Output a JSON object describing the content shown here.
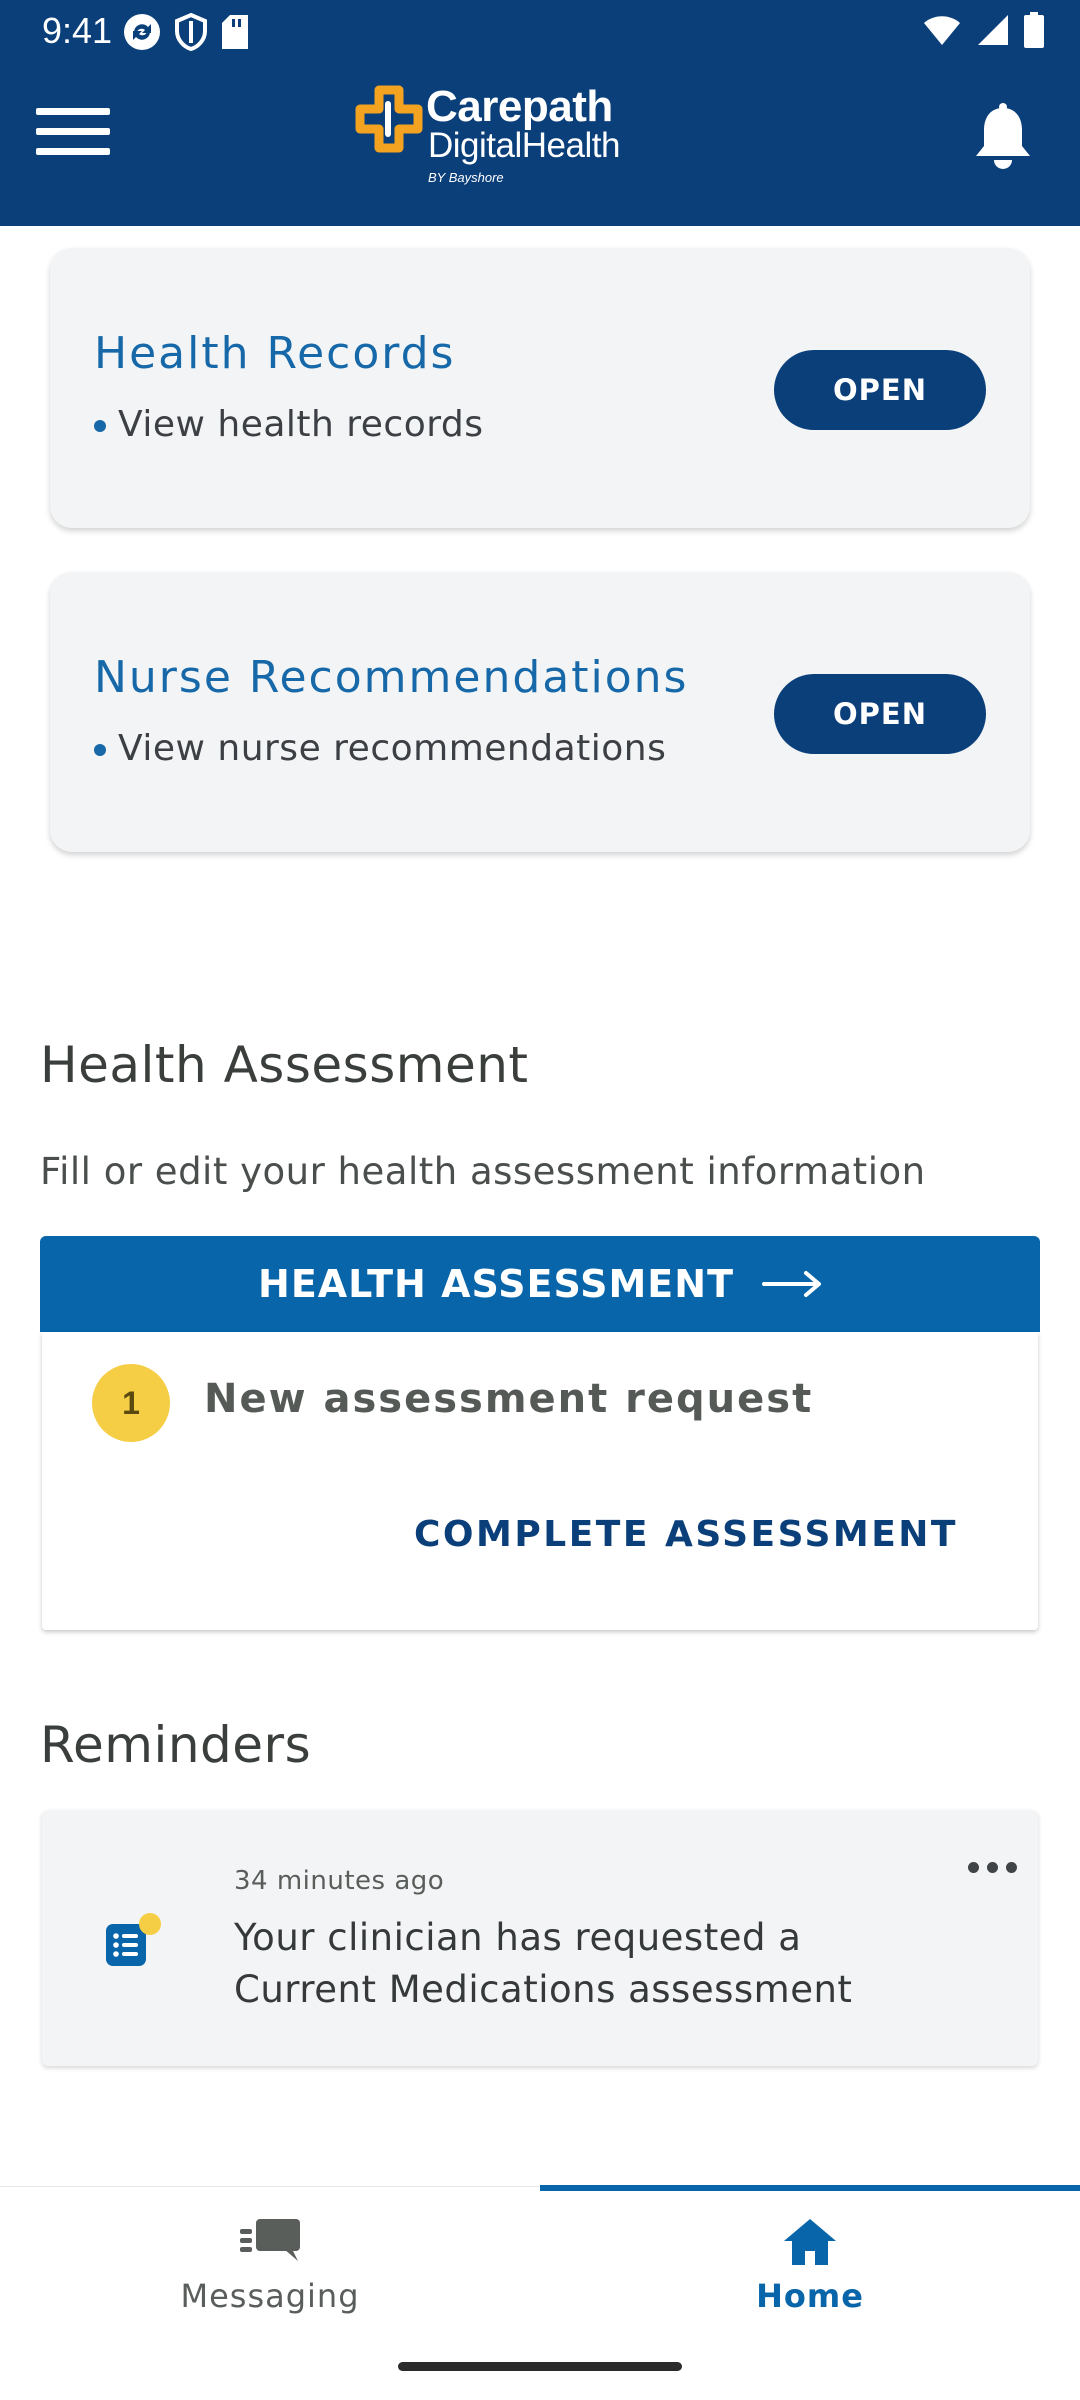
{
  "status_bar": {
    "time": "9:41"
  },
  "header": {
    "logo_line1": "Carepath",
    "logo_line2": "DigitalHealth",
    "logo_line3": "BY Bayshore"
  },
  "cards": [
    {
      "title": "Health Records",
      "subtitle": "View health records",
      "button": "OPEN"
    },
    {
      "title": "Nurse Recommendations",
      "subtitle": "View nurse recommendations",
      "button": "OPEN"
    }
  ],
  "health_assessment": {
    "title": "Health Assessment",
    "description": "Fill or edit your health assessment information",
    "button": "HEALTH ASSESSMENT",
    "badge_count": "1",
    "request_text": "New assessment request",
    "complete_link": "COMPLETE ASSESSMENT"
  },
  "reminders": {
    "title": "Reminders",
    "items": [
      {
        "time": "34 minutes ago",
        "text": "Your clinician has requested a Current Medications assessment"
      }
    ]
  },
  "bottom_nav": [
    {
      "label": "Messaging",
      "icon": "chat-bubbles-icon",
      "active": false
    },
    {
      "label": "Home",
      "icon": "home-icon",
      "active": true
    }
  ],
  "colors": {
    "header_bg": "#0b3f7a",
    "accent_blue": "#0865a9",
    "card_title": "#1768a8",
    "badge_yellow": "#f6ce45",
    "logo_orange": "#f4a321"
  }
}
